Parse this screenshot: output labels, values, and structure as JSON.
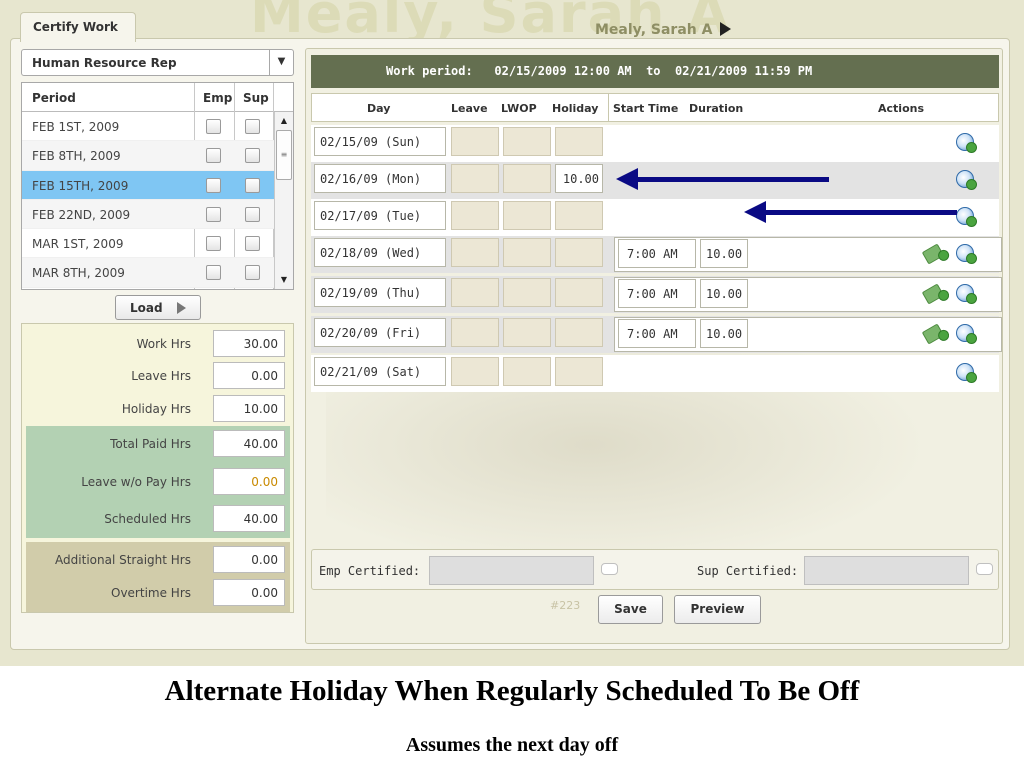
{
  "app": {
    "tab_label": "Certify Work",
    "watermark": "Mealy, Sarah A",
    "employee_name": "Mealy, Sarah A"
  },
  "left": {
    "role": "Human Resource Rep",
    "period_headers": {
      "period": "Period",
      "emp": "Emp",
      "sup": "Sup"
    },
    "periods": [
      {
        "label": "FEB 1ST, 2009"
      },
      {
        "label": "FEB 8TH, 2009"
      },
      {
        "label": "FEB 15TH, 2009",
        "selected": true
      },
      {
        "label": "FEB 22ND, 2009"
      },
      {
        "label": "MAR 1ST, 2009"
      },
      {
        "label": "MAR 8TH, 2009"
      }
    ],
    "load_label": "Load",
    "hours": [
      {
        "label": "Work Hrs",
        "value": "30.00"
      },
      {
        "label": "Leave Hrs",
        "value": "0.00"
      },
      {
        "label": "Holiday Hrs",
        "value": "10.00"
      },
      {
        "label": "Total Paid Hrs",
        "value": "40.00"
      },
      {
        "label": "Leave w/o Pay Hrs",
        "value": "0.00"
      },
      {
        "label": "Scheduled Hrs",
        "value": "40.00"
      },
      {
        "label": "Additional Straight Hrs",
        "value": "0.00"
      },
      {
        "label": "Overtime Hrs",
        "value": "0.00"
      }
    ]
  },
  "right": {
    "work_period": "Work period:   02/15/2009 12:00 AM  to  02/21/2009 11:59 PM",
    "columns": {
      "day": "Day",
      "leave": "Leave",
      "lwop": "LWOP",
      "holiday": "Holiday",
      "start": "Start Time",
      "duration": "Duration",
      "actions": "Actions"
    },
    "days": [
      {
        "day": "02/15/09 (Sun)",
        "holiday": "",
        "start": "",
        "duration": ""
      },
      {
        "day": "02/16/09 (Mon)",
        "holiday": "10.00",
        "start": "",
        "duration": ""
      },
      {
        "day": "02/17/09 (Tue)",
        "holiday": "",
        "start": "",
        "duration": ""
      },
      {
        "day": "02/18/09 (Wed)",
        "holiday": "",
        "start": "7:00 AM",
        "duration": "10.00"
      },
      {
        "day": "02/19/09 (Thu)",
        "holiday": "",
        "start": "7:00 AM",
        "duration": "10.00"
      },
      {
        "day": "02/20/09 (Fri)",
        "holiday": "",
        "start": "7:00 AM",
        "duration": "10.00"
      },
      {
        "day": "02/21/09 (Sat)",
        "holiday": "",
        "start": "",
        "duration": ""
      }
    ],
    "emp_certified_label": "Emp Certified:",
    "sup_certified_label": "Sup Certified:",
    "record_id": "#223",
    "save_label": "Save",
    "preview_label": "Preview"
  },
  "caption": {
    "title": "Alternate Holiday When Regularly Scheduled To Be Off",
    "subtitle": "Assumes the next day off"
  },
  "colors": {
    "header_bar": "#646f50",
    "selected_row": "#7fc6f3",
    "green_band": "#b3d1b3",
    "tan_band": "#d1ccaa",
    "annotation_arrow": "#0a0a84"
  }
}
